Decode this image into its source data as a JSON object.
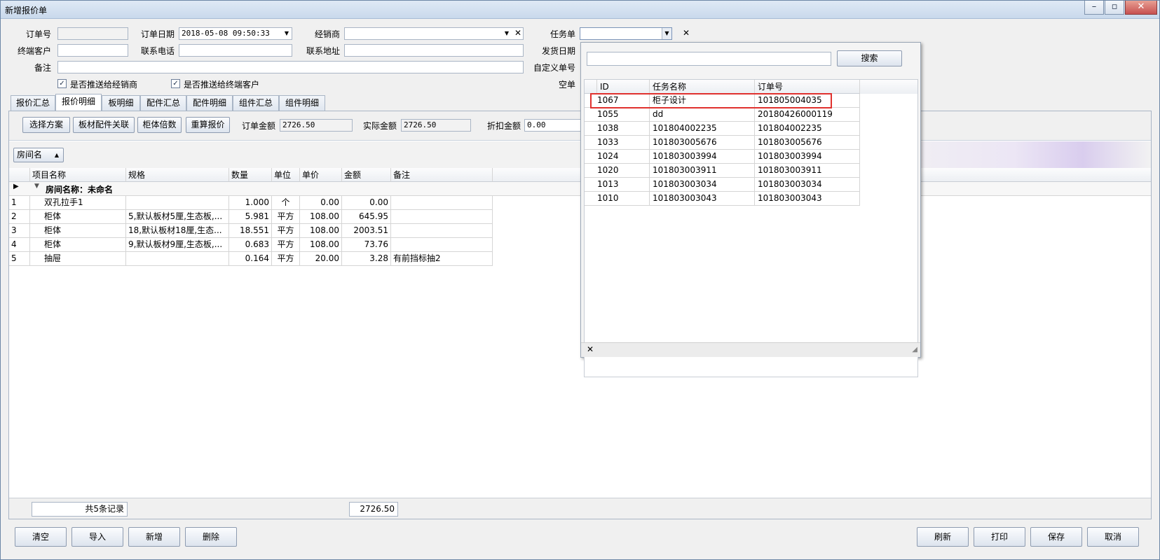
{
  "window": {
    "title": "新增报价单",
    "controls": [
      "–",
      "▫",
      "✕"
    ]
  },
  "form": {
    "order_no_label": "订单号",
    "order_no_value": "",
    "order_date_label": "订单日期",
    "order_date_value": "2018-05-08 09:50:33",
    "dealer_label": "经销商",
    "dealer_value": "",
    "task_label": "任务单",
    "task_value": "",
    "end_customer_label": "终端客户",
    "phone_label": "联系电话",
    "address_label": "联系地址",
    "ship_date_label": "发货日期",
    "remark_label": "备注",
    "custom_no_label": "自定义单号",
    "empty_label": "空单",
    "push_dealer_label": "是否推送给经销商",
    "push_dealer_checked": true,
    "push_customer_label": "是否推送给终端客户",
    "push_customer_checked": true
  },
  "tabs": [
    {
      "label": "报价汇总"
    },
    {
      "label": "报价明细"
    },
    {
      "label": "板明细"
    },
    {
      "label": "配件汇总"
    },
    {
      "label": "配件明细"
    },
    {
      "label": "组件汇总"
    },
    {
      "label": "组件明细"
    }
  ],
  "active_tab": "报价明细",
  "toolbar": {
    "select_plan": "选择方案",
    "board_link": "板材配件关联",
    "cabinet_multiple": "柜体倍数",
    "recalc": "重算报价",
    "order_amount_label": "订单金额",
    "order_amount_value": "2726.50",
    "actual_amount_label": "实际金额",
    "actual_amount_value": "2726.50",
    "discount_label": "折扣金额",
    "discount_value": "0.00"
  },
  "group_panel": {
    "chip_label": "房间名",
    "chip_arrow": "▲"
  },
  "grid": {
    "columns": [
      "项目名称",
      "规格",
      "数量",
      "单位",
      "单价",
      "金额",
      "备注"
    ],
    "group_label": "房间名称：未命名",
    "rows": [
      {
        "no": "1",
        "name": "双孔拉手1",
        "spec": "",
        "qty": "1.000",
        "unit": "个",
        "price": "0.00",
        "amount": "0.00",
        "remark": ""
      },
      {
        "no": "2",
        "name": "柜体",
        "spec": "5,默认板材5厘,生态板,...",
        "qty": "5.981",
        "unit": "平方",
        "price": "108.00",
        "amount": "645.95",
        "remark": ""
      },
      {
        "no": "3",
        "name": "柜体",
        "spec": "18,默认板材18厘,生态...",
        "qty": "18.551",
        "unit": "平方",
        "price": "108.00",
        "amount": "2003.51",
        "remark": ""
      },
      {
        "no": "4",
        "name": "柜体",
        "spec": "9,默认板材9厘,生态板,...",
        "qty": "0.683",
        "unit": "平方",
        "price": "108.00",
        "amount": "73.76",
        "remark": ""
      },
      {
        "no": "5",
        "name": "抽屉",
        "spec": "",
        "qty": "0.164",
        "unit": "平方",
        "price": "20.00",
        "amount": "3.28",
        "remark": "有前挡标抽2"
      }
    ],
    "footer_count": "共5条记录",
    "footer_sum": "2726.50"
  },
  "bottom_buttons": {
    "clear": "清空",
    "import": "导入",
    "add": "新增",
    "delete": "删除",
    "refresh": "刷新",
    "print": "打印",
    "save": "保存",
    "cancel": "取消"
  },
  "popup": {
    "search_value": "",
    "search_button": "搜索",
    "columns": [
      "ID",
      "任务名称",
      "订单号"
    ],
    "rows": [
      {
        "id": "1067",
        "name": "柜子设计",
        "order": "101805004035"
      },
      {
        "id": "1055",
        "name": "dd",
        "order": "20180426000119"
      },
      {
        "id": "1038",
        "name": "101804002235",
        "order": "101804002235"
      },
      {
        "id": "1033",
        "name": "101803005676",
        "order": "101803005676"
      },
      {
        "id": "1024",
        "name": "101803003994",
        "order": "101803003994"
      },
      {
        "id": "1020",
        "name": "101803003911",
        "order": "101803003911"
      },
      {
        "id": "1013",
        "name": "101803003034",
        "order": "101803003034"
      },
      {
        "id": "1010",
        "name": "101803003043",
        "order": "101803003043"
      }
    ],
    "highlight_color": "#e0312e"
  }
}
